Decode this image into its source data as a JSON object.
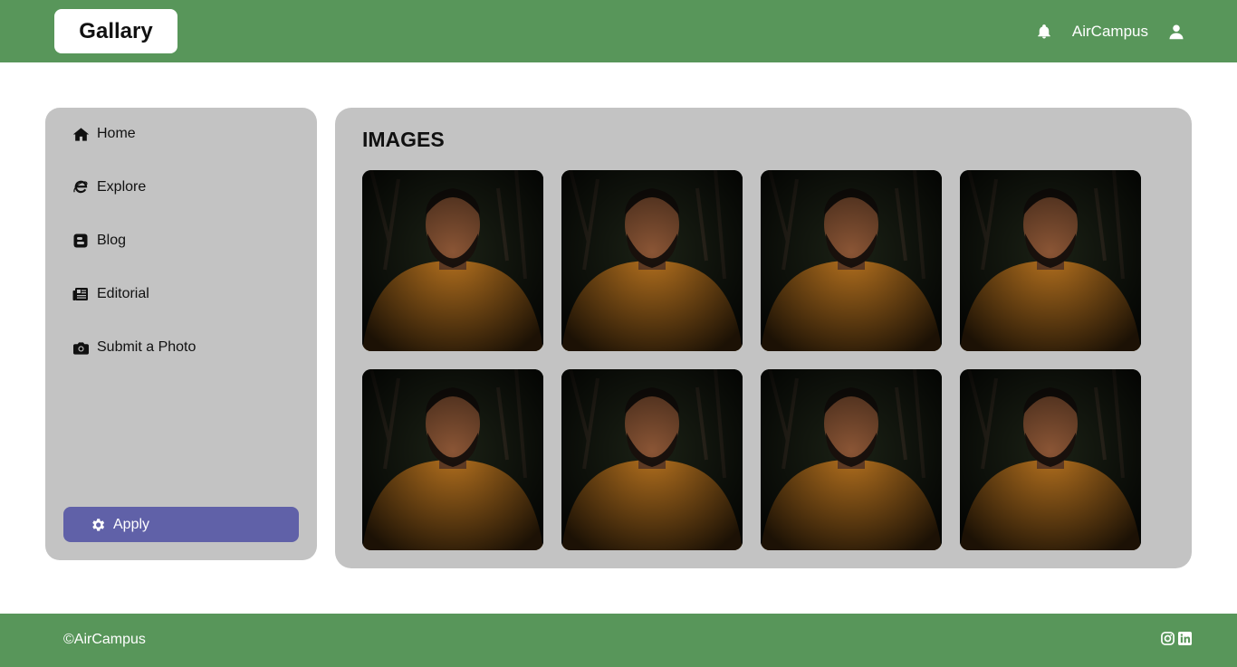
{
  "header": {
    "logo": "Gallary",
    "brand": "AirCampus",
    "icons": [
      "bell-icon",
      "user-icon"
    ]
  },
  "sidebar": {
    "items": [
      {
        "label": "Home",
        "icon": "home-icon"
      },
      {
        "label": "Explore",
        "icon": "internet-explorer-icon"
      },
      {
        "label": "Blog",
        "icon": "blogger-icon"
      },
      {
        "label": "Editorial",
        "icon": "newspaper-icon"
      },
      {
        "label": "Submit a Photo",
        "icon": "camera-icon"
      }
    ],
    "apply_label": "Apply"
  },
  "main": {
    "title": "IMAGES",
    "image_count": 8
  },
  "footer": {
    "copyright": "©AirCampus",
    "social_icons": [
      "instagram-icon",
      "linkedin-icon"
    ]
  },
  "colors": {
    "header_bg": "#58965a",
    "panel_bg": "#c3c3c3",
    "apply_bg": "#6061a8"
  }
}
